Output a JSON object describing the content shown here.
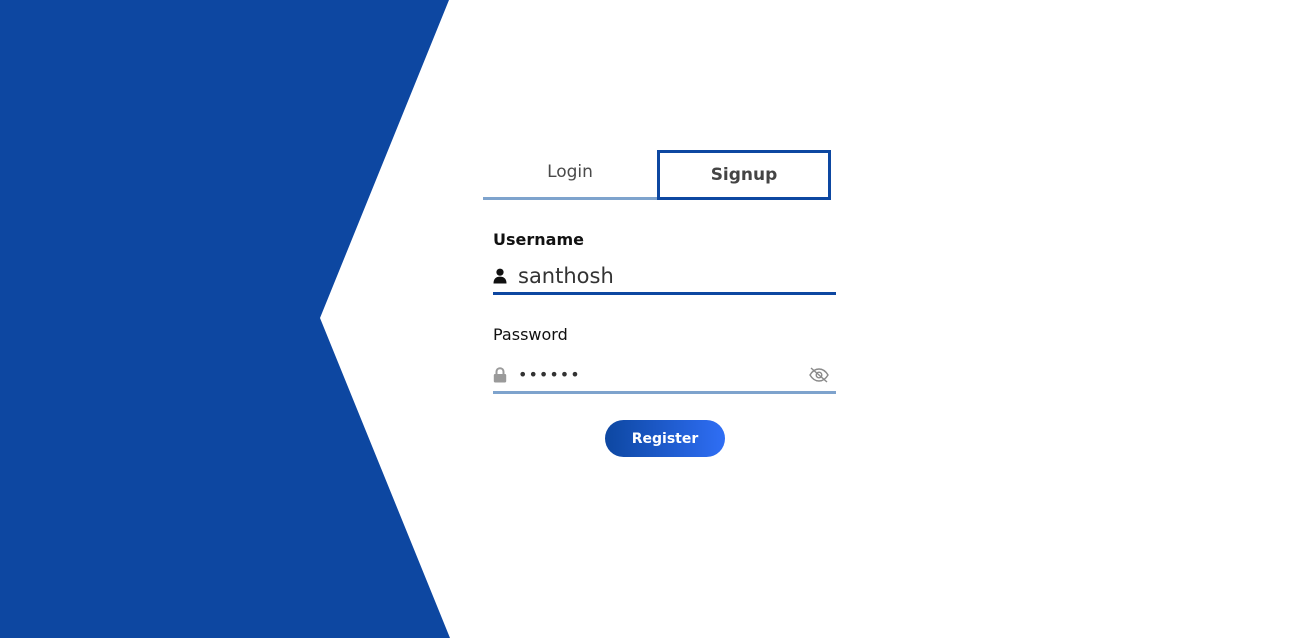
{
  "colors": {
    "brand": "#0d47a1",
    "accent_light": "#7ea3cd",
    "button_gradient_end": "#2f6ef5"
  },
  "tabs": [
    {
      "label": "Login",
      "active": false
    },
    {
      "label": "Signup",
      "active": true
    }
  ],
  "username": {
    "label": "Username",
    "value": "santhosh",
    "icon": "user-icon"
  },
  "password": {
    "label": "Password",
    "value": "••••••",
    "icon": "lock-icon",
    "toggle_icon": "eye-off-icon"
  },
  "register_button": {
    "label": "Register"
  }
}
